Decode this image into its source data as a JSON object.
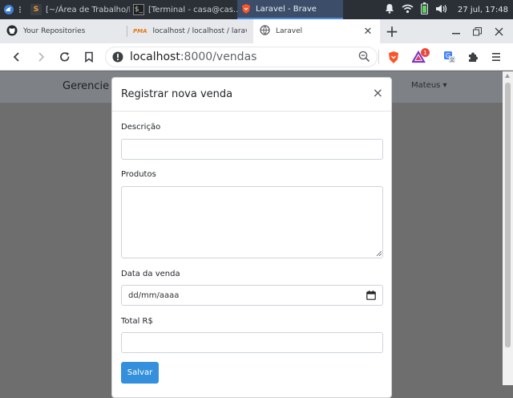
{
  "taskbar": {
    "tasks": [
      {
        "label": "[~/Área de Trabalho/F..."
      },
      {
        "label": "[Terminal - casa@cas..."
      },
      {
        "label": "Laravel - Brave"
      }
    ],
    "clock": "27 jul, 17:48"
  },
  "browser": {
    "tabs": [
      {
        "label": "Your Repositories"
      },
      {
        "label": "localhost / localhost / larav"
      },
      {
        "label": "Laravel"
      }
    ],
    "url_host": "localhost",
    "url_path": ":8000/vendas",
    "rewards_badge": "1"
  },
  "app": {
    "brand": "Gerencie su",
    "user": "Mateus ▾"
  },
  "modal": {
    "title": "Registrar nova venda",
    "close": "×",
    "fields": {
      "descricao_label": "Descrição",
      "descricao_value": "",
      "produtos_label": "Produtos",
      "produtos_value": "",
      "data_label": "Data da venda",
      "data_placeholder": "dd/mm/aaaa",
      "total_label": "Total R$",
      "total_value": ""
    },
    "save_label": "Salvar"
  },
  "colors": {
    "accent": "#3490dc",
    "overlay": "#6e6e6e",
    "taskbar": "#2b3036"
  }
}
